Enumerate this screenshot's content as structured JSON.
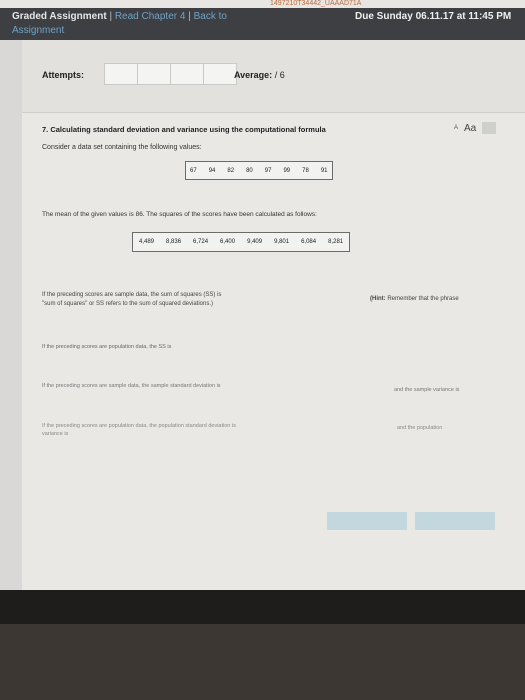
{
  "browser": {
    "url_fragment": "1497210T34442_UAAAD71A"
  },
  "header": {
    "title": "Graded Assignment",
    "separator": "|",
    "read_chapter": "Read Chapter 4",
    "back_to": "Back to",
    "assignment": "Assignment",
    "due": "Due Sunday 06.11.17 at 11:45 PM"
  },
  "attempts": {
    "label": "Attempts:",
    "average_label": "Average:",
    "average_value": " / 6"
  },
  "question": {
    "title": "7. Calculating standard deviation and variance using the computational formula",
    "intro": "Consider a data set containing the following values:",
    "values": [
      "67",
      "94",
      "82",
      "80",
      "97",
      "99",
      "78",
      "91"
    ],
    "mean_text": "The mean of the given values is 86. The squares of the scores have been calculated as follows:",
    "squares": [
      "4,489",
      "8,836",
      "6,724",
      "6,400",
      "9,409",
      "9,801",
      "6,084",
      "8,281"
    ],
    "p1_line1": "If the preceding scores are sample data, the sum of squares (SS) is",
    "p1_line2": "\"sum of squares\" or SS refers to the sum of squared deviations.)",
    "hint_bold": "(Hint:",
    "hint_rest": " Remember that the phrase",
    "p2": "If the preceding scores are population data, the SS is",
    "p3": "If the preceding scores are sample data, the sample standard deviation is",
    "p3b": "and the sample variance is",
    "p4_line1": "If the preceding scores are population data, the population standard deviation is",
    "p4_line2": "variance is",
    "p4b": "and the population"
  },
  "font_size": {
    "small": "A",
    "big": "Aa"
  },
  "taskbar": {
    "icons": [
      "windows-icon",
      "task-view-icon",
      "notes-icon",
      "store-icon",
      "chrome-icon",
      "folder-icon",
      "photos-icon",
      "ie-icon",
      "mail-icon",
      "maps-icon",
      "edge-icon"
    ]
  }
}
